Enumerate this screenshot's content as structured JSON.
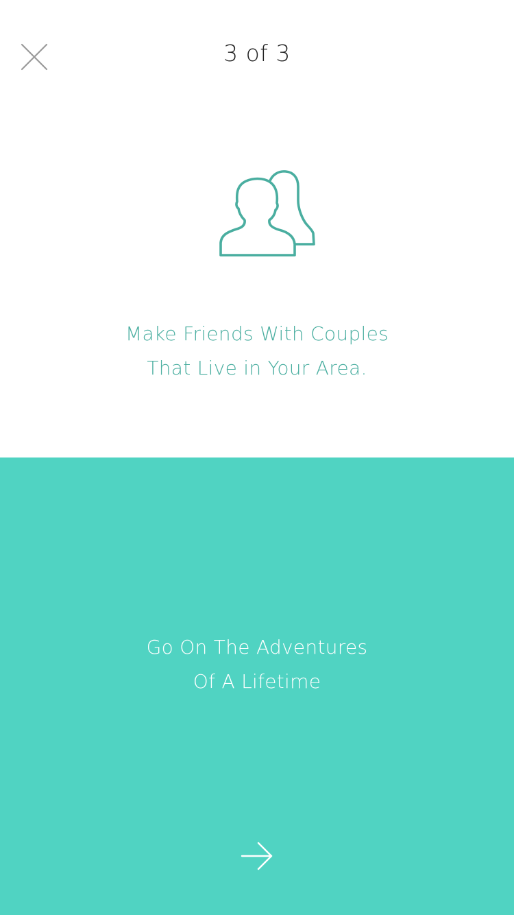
{
  "header": {
    "page_indicator": "3 of 3",
    "close_icon": "close-icon"
  },
  "feature": {
    "icon": "couple-icon",
    "line1": "Make Friends With Couples",
    "line2": "That Live in Your Area.",
    "color": "#4aaea0"
  },
  "panel": {
    "background": "#50d3c2",
    "line1": "Go On The Adventures",
    "line2": "Of A Lifetime",
    "next_icon": "arrow-right-icon"
  }
}
